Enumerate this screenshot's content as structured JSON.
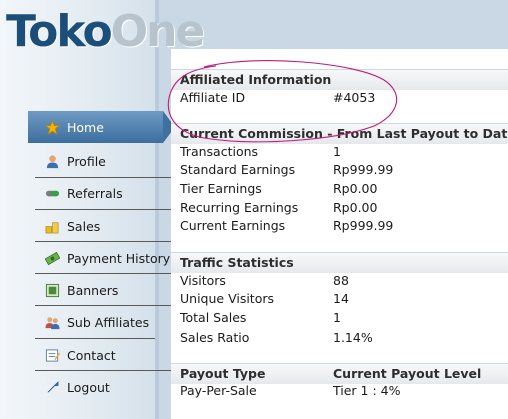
{
  "logo": {
    "part1": "Toko",
    "part2": "One"
  },
  "menu": [
    {
      "label": "Home",
      "icon": "star-icon",
      "active": true
    },
    {
      "label": "Profile",
      "icon": "user-icon"
    },
    {
      "label": "Referrals",
      "icon": "referrals-icon"
    },
    {
      "label": "Sales",
      "icon": "coins-icon"
    },
    {
      "label": "Payment History",
      "icon": "money-icon"
    },
    {
      "label": "Banners",
      "icon": "banner-icon"
    },
    {
      "label": "Sub Affiliates",
      "icon": "users-icon"
    },
    {
      "label": "Contact",
      "icon": "contact-icon"
    },
    {
      "label": "Logout",
      "icon": "logout-icon"
    }
  ],
  "affiliated": {
    "title": "Affiliated Information",
    "rows": [
      {
        "label": "Affiliate ID",
        "value": "#4053"
      }
    ]
  },
  "commission": {
    "title": "Current Commission - From Last Payout to Date",
    "rows": [
      {
        "label": "Transactions",
        "value": "1"
      },
      {
        "label": "Standard Earnings",
        "value": "Rp999.99"
      },
      {
        "label": "Tier Earnings",
        "value": "Rp0.00"
      },
      {
        "label": "Recurring Earnings",
        "value": "Rp0.00"
      },
      {
        "label": "Current Earnings",
        "value": "Rp999.99"
      }
    ]
  },
  "traffic": {
    "title": "Traffic Statistics",
    "rows": [
      {
        "label": "Visitors",
        "value": "88"
      },
      {
        "label": "Unique Visitors",
        "value": "14"
      },
      {
        "label": "Total Sales",
        "value": "1"
      },
      {
        "label": "Sales Ratio",
        "value": "1.14%"
      }
    ]
  },
  "payout": {
    "title_left": "Payout Type",
    "title_right": "Current Payout Level",
    "rows": [
      {
        "label": "Pay-Per-Sale",
        "value": "Tier 1 : 4%"
      }
    ]
  },
  "colors": {
    "accent": "#3c6e9e",
    "annotation": "#c2187a"
  }
}
